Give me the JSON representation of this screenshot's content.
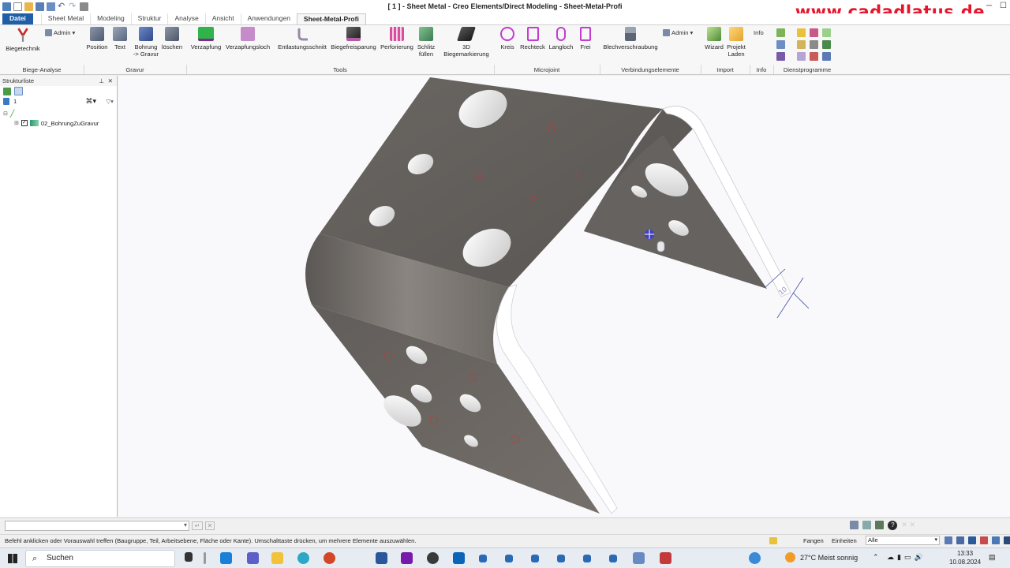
{
  "window": {
    "title": "[ 1 ] - Sheet Metal - Creo Elements/Direct Modeling - Sheet-Metal-Profi",
    "brand": "www.cadadlatus.de"
  },
  "tabs": [
    "Datei",
    "Sheet Metal",
    "Modeling",
    "Struktur",
    "Analyse",
    "Ansicht",
    "Anwendungen",
    "Sheet-Metal-Profi"
  ],
  "ribbon": {
    "admin_label": "Admin",
    "info_label": "Info",
    "buttons": {
      "biegetechnik": "Biegetechnik",
      "position": "Position",
      "text": "Text",
      "bohrung_line1": "Bohrung",
      "bohrung_line2": "-> Gravur",
      "loeschen": "löschen",
      "verzapfung": "Verzapfung",
      "verzapfungsloch": "Verzapfungsloch",
      "entlastungsschnitt": "Entlastungsschnitt",
      "biegefreisparung": "Biegefreisparung",
      "perforierung": "Perforierung",
      "schlitz_line1": "Schlitz",
      "schlitz_line2": "füllen",
      "bieg3d_line1": "3D",
      "bieg3d_line2": "Biegemarkierung",
      "kreis": "Kreis",
      "rechteck": "Rechteck",
      "langloch": "Langloch",
      "frei": "Frei",
      "blechverschraubung": "Blechverschraubung",
      "wizard": "Wizard",
      "projekt_line1": "Projekt",
      "projekt_line2": "Laden"
    },
    "groups": {
      "biege_analyse": "Biege-Analyse",
      "gravur": "Gravur",
      "tools": "Tools",
      "microjoint": "Microjoint",
      "verbindungselemente": "Verbindungselemente",
      "import": "Import",
      "info": "Info",
      "dienstprogramme": "Dienstprogramme"
    }
  },
  "structure_panel": {
    "title": "Strukturliste",
    "row_number": "1",
    "tree_item": "02_BohrungZuGravur"
  },
  "viewport": {
    "dimension_label": "10"
  },
  "statusbar": {
    "message": "Befehl anklicken oder Vorauswahl treffen (Baugruppe, Teil, Arbeitsebene, Fläche oder Kante). Umschalttaste drücken, um mehrere Elemente auszuwählen.",
    "fangen": "Fangen",
    "einheiten": "Einheiten",
    "filter_value": "Alle"
  },
  "taskbar": {
    "search_label": "Suchen",
    "weather": "27°C  Meist sonnig",
    "time": "13:33",
    "date": "10.08.2024"
  },
  "colors": {
    "brand_red": "#e8142c",
    "file_tab_blue": "#1f5fa8",
    "sheet_metal_gray": "#6e6a66",
    "hole_marker_red": "#d23232"
  }
}
